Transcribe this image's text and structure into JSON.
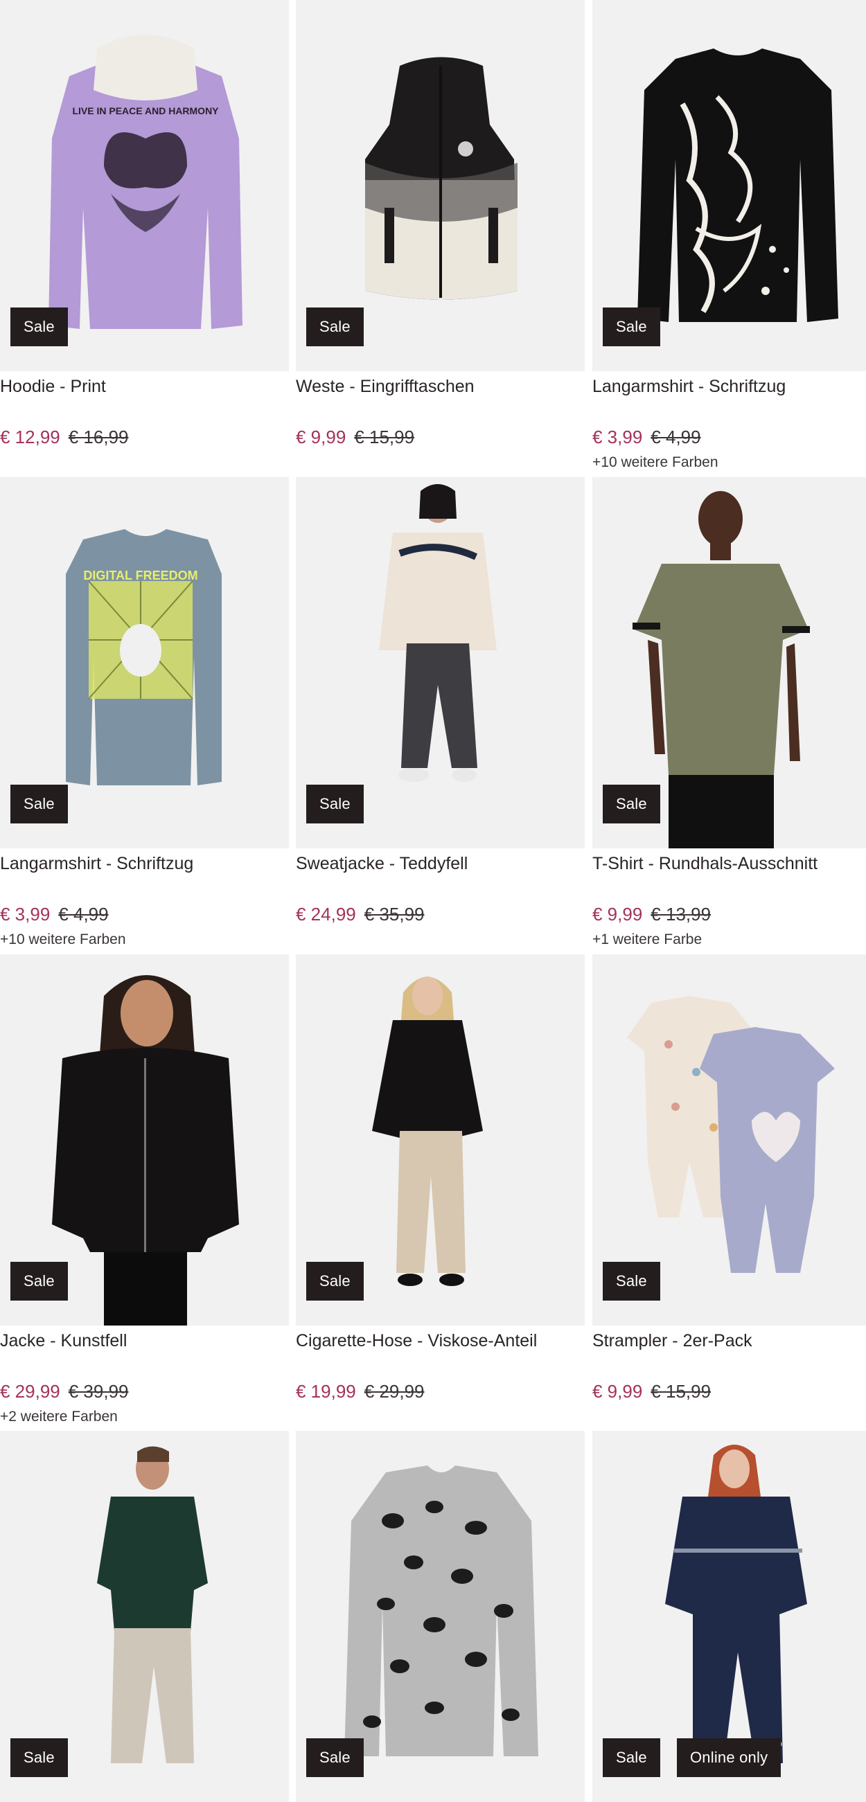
{
  "products": [
    {
      "title": "Hoodie - Print",
      "price": "€ 12,99",
      "old_price": "€ 16,99",
      "colors": "",
      "badges": [
        "Sale"
      ],
      "image": "purple-hoodie-butterfly-print",
      "print": "LIVE IN PEACE AND HARMONY"
    },
    {
      "title": "Weste - Eingrifftaschen",
      "price": "€ 9,99",
      "old_price": "€ 15,99",
      "colors": "",
      "badges": [
        "Sale"
      ],
      "image": "black-white-vest"
    },
    {
      "title": "Langarmshirt - Schriftzug",
      "price": "€ 3,99",
      "old_price": "€ 4,99",
      "colors": "+10 weitere Farben",
      "badges": [
        "Sale"
      ],
      "image": "black-longsleeve-graffiti"
    },
    {
      "title": "Langarmshirt - Schriftzug",
      "price": "€ 3,99",
      "old_price": "€ 4,99",
      "colors": "+10 weitere Farben",
      "badges": [
        "Sale"
      ],
      "image": "blue-longsleeve-print",
      "print": "DIGITAL FREEDOM"
    },
    {
      "title": "Sweatjacke - Teddyfell",
      "price": "€ 24,99",
      "old_price": "€ 35,99",
      "colors": "",
      "badges": [
        "Sale"
      ],
      "image": "model-teddy-jacket"
    },
    {
      "title": "T-Shirt - Rundhals-Ausschnitt",
      "price": "€ 9,99",
      "old_price": "€ 13,99",
      "colors": "+1 weitere Farbe",
      "badges": [
        "Sale"
      ],
      "image": "model-olive-tshirt"
    },
    {
      "title": "Jacke - Kunstfell",
      "price": "€ 29,99",
      "old_price": "€ 39,99",
      "colors": "+2 weitere Farben",
      "badges": [
        "Sale"
      ],
      "image": "model-black-faux-fur-jacket"
    },
    {
      "title": "Cigarette-Hose - Viskose-Anteil",
      "price": "€ 19,99",
      "old_price": "€ 29,99",
      "colors": "",
      "badges": [
        "Sale"
      ],
      "image": "model-beige-trousers"
    },
    {
      "title": "Strampler - 2er-Pack",
      "price": "€ 9,99",
      "old_price": "€ 15,99",
      "colors": "",
      "badges": [
        "Sale"
      ],
      "image": "baby-rompers-2pack"
    },
    {
      "title": "",
      "price": "",
      "old_price": "",
      "colors": "",
      "badges": [
        "Sale"
      ],
      "image": "model-green-sweater-cargo"
    },
    {
      "title": "",
      "price": "",
      "old_price": "",
      "colors": "",
      "badges": [
        "Sale"
      ],
      "image": "leopard-shirt-jacket"
    },
    {
      "title": "",
      "price": "",
      "old_price": "",
      "colors": "",
      "badges": [
        "Sale",
        "Online only"
      ],
      "image": "model-navy-rain-suit"
    }
  ],
  "colors": {
    "price_sale": "#a5315c",
    "badge_bg": "#231d1e",
    "image_bg": "#f1f1f1"
  }
}
